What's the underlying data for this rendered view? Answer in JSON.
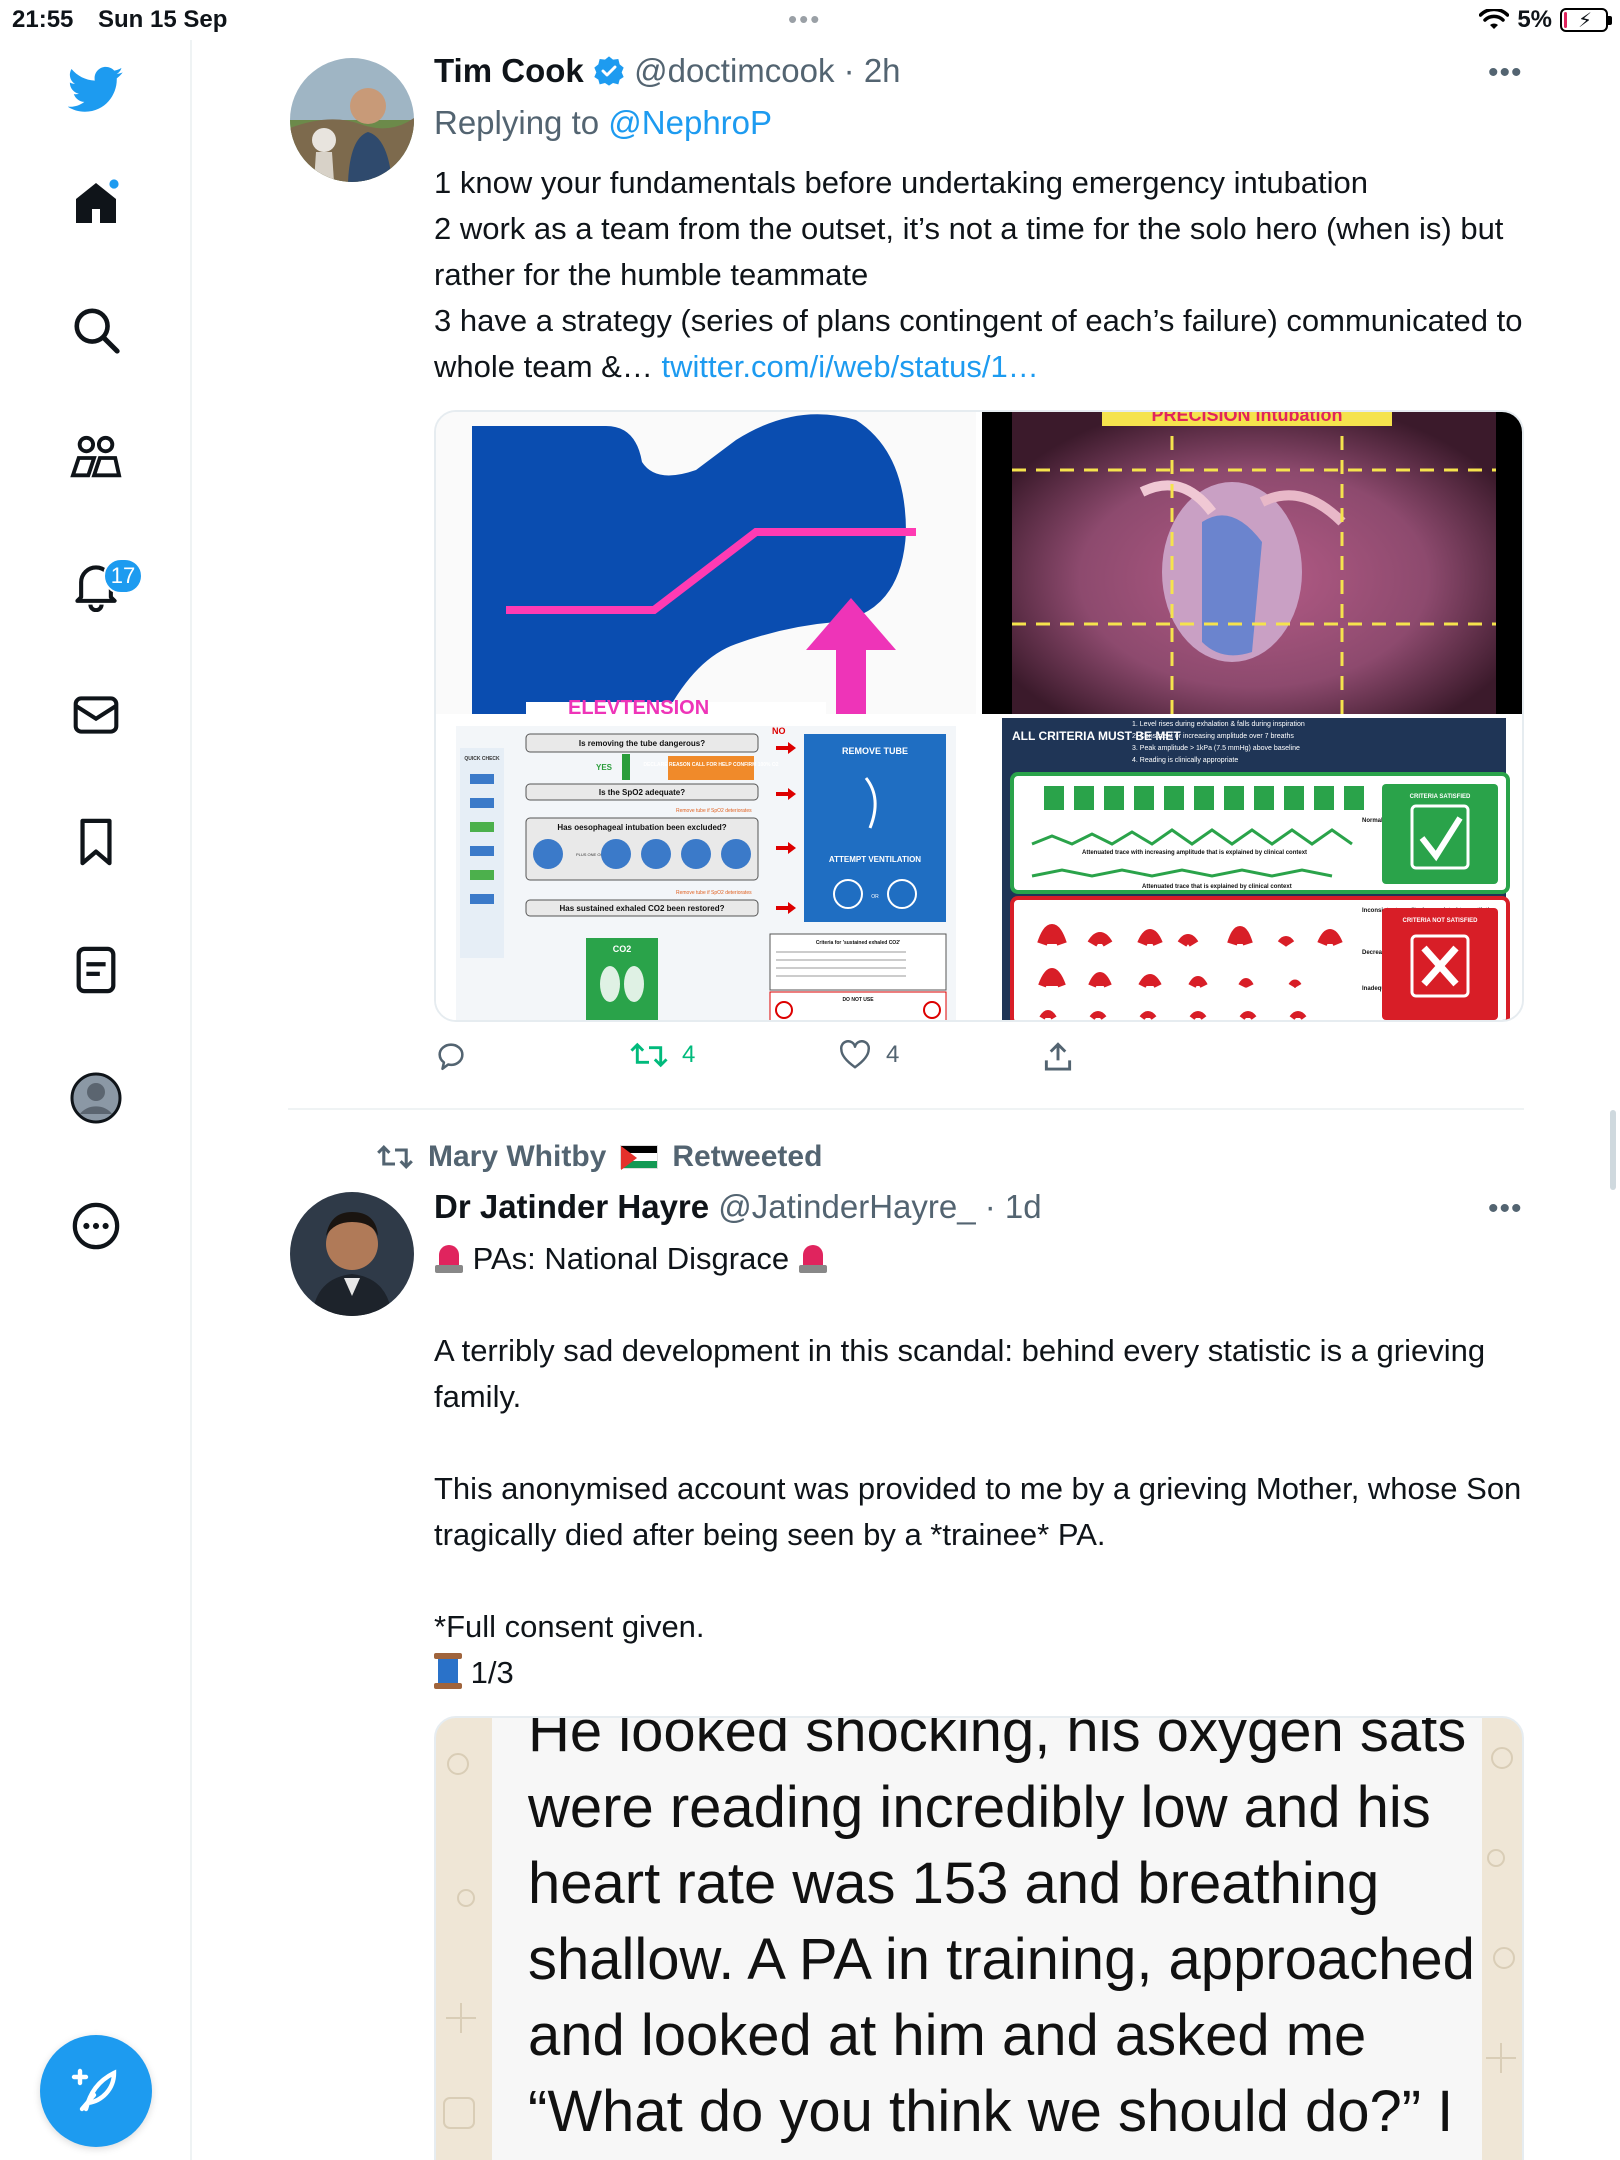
{
  "status_bar": {
    "time": "21:55",
    "date": "Sun 15 Sep",
    "battery": "5%"
  },
  "sidebar": {
    "items": [
      {
        "name": "twitter-logo"
      },
      {
        "name": "home"
      },
      {
        "name": "search"
      },
      {
        "name": "communities"
      },
      {
        "name": "notifications",
        "badge": "17"
      },
      {
        "name": "messages"
      },
      {
        "name": "bookmarks"
      },
      {
        "name": "lists"
      },
      {
        "name": "profile"
      },
      {
        "name": "more"
      }
    ],
    "compose_icon": "feather-plus-icon"
  },
  "tweet1": {
    "name": "Tim Cook",
    "handle": "@doctimcook",
    "time": "· 2h",
    "replying_prefix": "Replying to",
    "replying_handle": "@NephroP",
    "line1": "1 know your fundamentals before undertaking emergency intubation",
    "line2": "2 work as a team from the outset, it’s not a time for the solo hero (when is) but rather for the humble teammate",
    "line3": "3 have a strategy (series of plans contingent of each’s failure) communicated to whole team &…",
    "link": "twitter.com/i/web/status/1…",
    "media": {
      "img1_label": "ELEVTENSION",
      "img2_label": "PRECISION intubation",
      "img3": {
        "q1": "Is removing the tube dangerous?",
        "yes": "YES",
        "no": "NO",
        "declare": "DECLARE REASON CALL FOR HELP CONFIRM 100% O2",
        "q2": "Is the SpO2 adequate?",
        "remove_if": "Remove tube if SpO2 deteriorates",
        "q3": "Has oesophageal intubation been excluded?",
        "plus_one_of": "PLUS ONE OF",
        "remove_if2": "Remove tube if SpO2 deteriorates",
        "q4": "Has sustained exhaled CO2 been restored?",
        "remove_tube": "REMOVE TUBE",
        "attempt_ventilation": "ATTEMPT VENTILATION",
        "or": "OR",
        "criteria_title": "Criteria for 'sustained exhaled CO2'",
        "do_not_use": "DO NOT USE",
        "co2": "CO2",
        "quick_check": "QUICK CHECK"
      },
      "img4": {
        "all_criteria": "ALL CRITERIA MUST BE MET",
        "c1": "1. Level rises during exhalation & falls during inspiration",
        "c2": "2. Consistent or increasing amplitude over 7 breaths",
        "c3": "3. Peak amplitude > 1kPa (7.5 mmHg) above baseline",
        "c4": "4. Reading is clinically appropriate",
        "normal_trace": "Normal trace",
        "attenuated_clinical": "Attenuated trace with increasing amplitude that is explained by clinical context",
        "attenuated_explained": "Attenuated trace that is explained by clinical context",
        "criteria_satisfied": "CRITERIA SATISFIED",
        "inconsistent": "Inconsistent amplitude, unrelated to ventilation",
        "decreasing": "Decreasing amplitude",
        "inadequate": "Inadequate amplitude",
        "criteria_not_satisfied": "CRITERIA NOT SATISFIED"
      }
    },
    "actions": {
      "retweets": "4",
      "likes": "4"
    }
  },
  "retweet_banner": {
    "retweeter": "Mary Whitby",
    "label": "Retweeted"
  },
  "tweet2": {
    "name": "Dr Jatinder Hayre",
    "handle": "@JatinderHayre_",
    "time": "· 1d",
    "headline": "PAs: National Disgrace",
    "para1": "A terribly sad development in this scandal: behind every statistic is a grieving family.",
    "para2": "This anonymised account was provided to me by a grieving Mother, whose Son tragically died after being seen by a *trainee* PA.",
    "para3": "*Full consent given.",
    "thread": "1/3",
    "image_text": "He looked shocking, his oxygen sats were reading incredibly low and his heart rate was 153 and breathing shallow. A PA in training, approached and looked at him and asked me “What do you think we should do?” I told him to test"
  },
  "colors": {
    "accent": "#1d9bf0",
    "text": "#0f1419",
    "muted": "#536471",
    "border": "#eff3f4"
  }
}
